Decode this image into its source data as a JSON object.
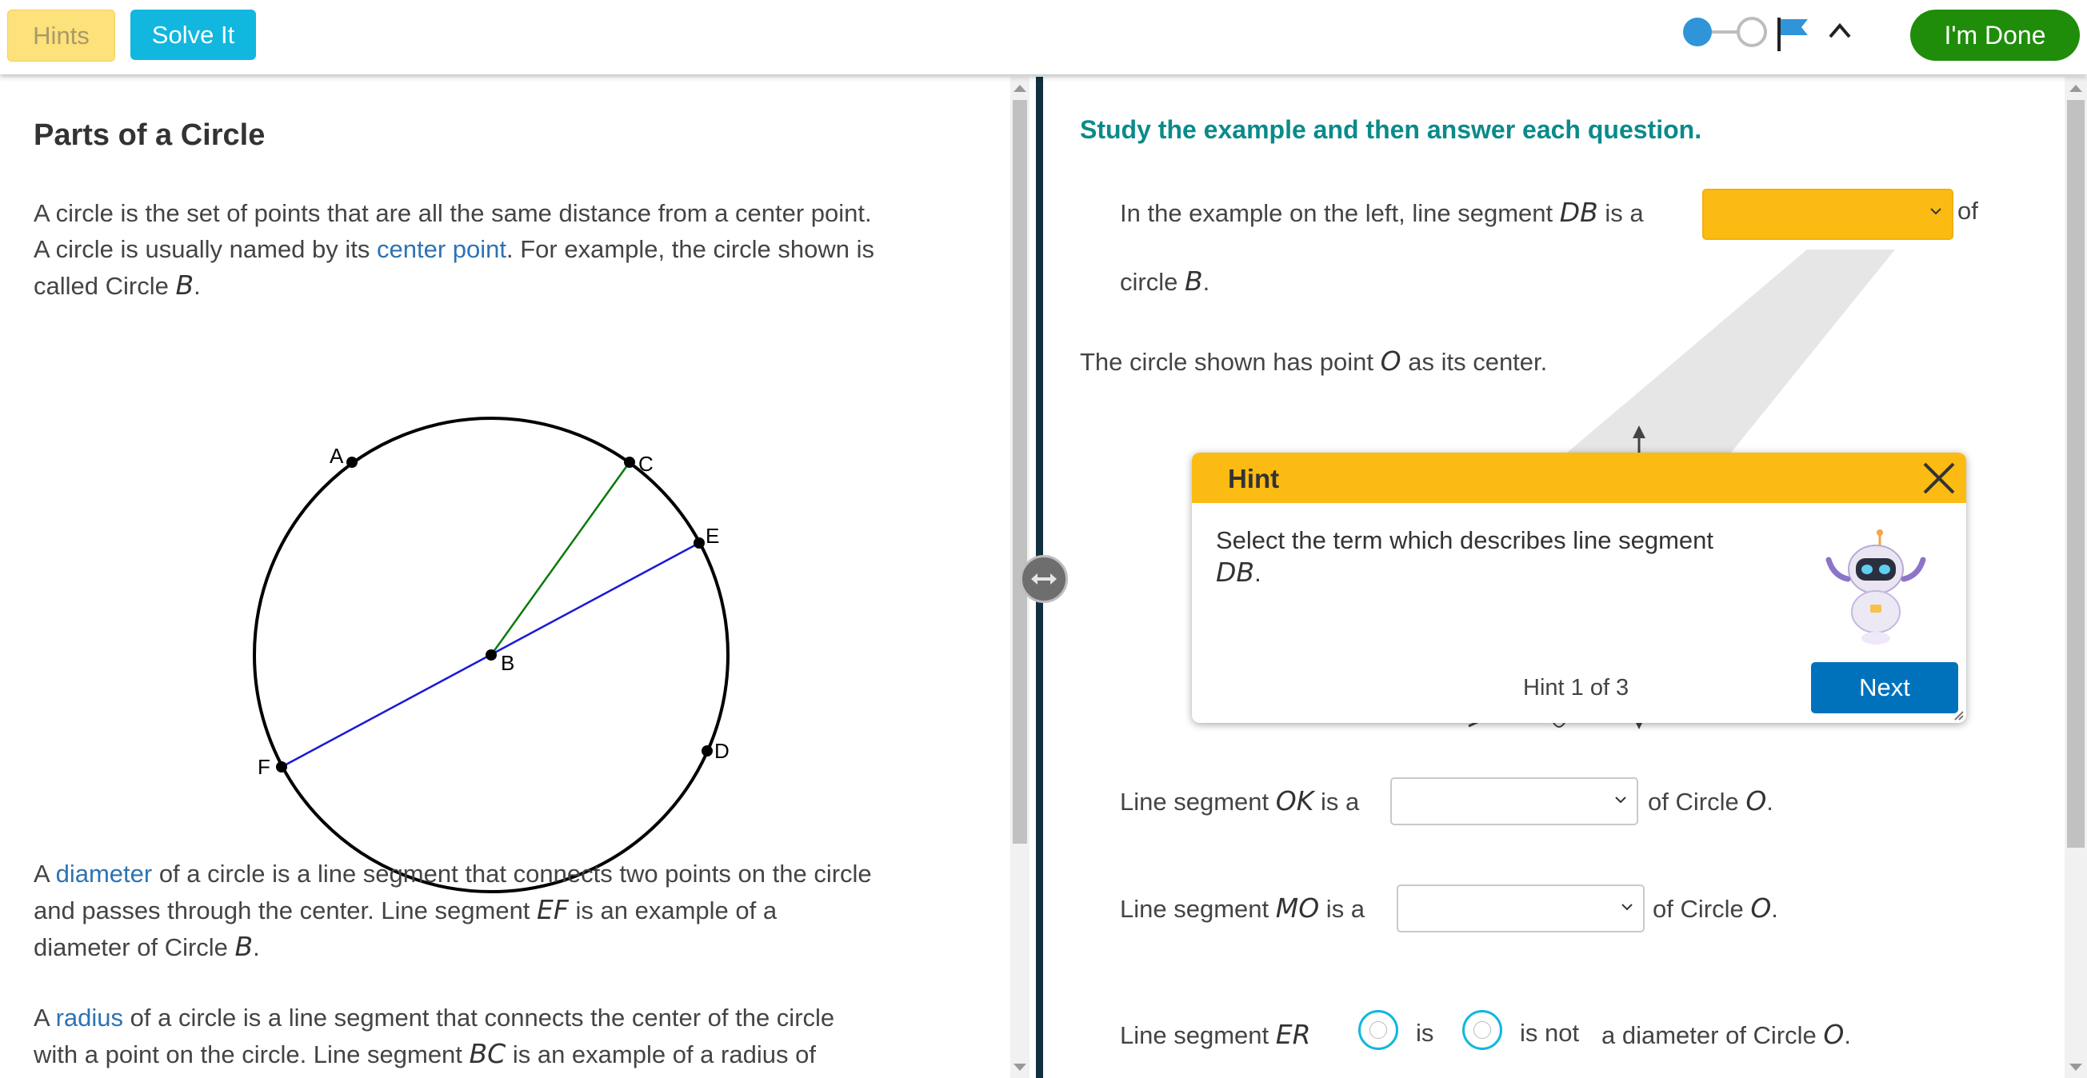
{
  "toolbar": {
    "hints_label": "Hints",
    "solve_label": "Solve It",
    "done_label": "I'm Done",
    "progress_icons": [
      "filled-step-icon",
      "empty-step-icon",
      "flag-icon",
      "collapse-caret-icon"
    ]
  },
  "lesson": {
    "title": "Parts of a Circle",
    "intro": {
      "p1": "A circle is the set of points that are all the same distance from a center point.",
      "p2_before": "A circle is usually named by its ",
      "p2_link": "center point",
      "p2_after": ". For example, the circle shown is",
      "p3_before": "called Circle ",
      "p3_var": "B",
      "p3_after": "."
    },
    "diagram_labels": {
      "A": "A",
      "B": "B",
      "C": "C",
      "D": "D",
      "E": "E",
      "F": "F"
    },
    "diameter_para": {
      "l1_before": "A ",
      "l1_link": "diameter",
      "l1_after": " of a circle is a line segment that connects two points on the circle",
      "l2_before": "and passes through the center. Line segment ",
      "l2_var": "EF",
      "l2_after": " is an example of a",
      "l3_before": "diameter of Circle ",
      "l3_var": "B",
      "l3_after": "."
    },
    "radius_para": {
      "l1_before": "A ",
      "l1_link": "radius",
      "l1_after": " of a circle is a line segment that connects the center of the circle",
      "l2_before": "with a point on the circle. Line segment ",
      "l2_var": "BC",
      "l2_after": " is an example of a radius of"
    }
  },
  "colors": {
    "accent_teal": "#0b8a8a",
    "hint_yellow": "#fcbb13",
    "solve_blue": "#11b7df",
    "done_green": "#1f8d0a",
    "next_blue": "#0072bc",
    "link_blue": "#2d73b3",
    "radius_green": "#0a7a0a",
    "diameter_blue": "#1a1ad6"
  },
  "questions": {
    "instructions": "Study the example and then answer each question.",
    "q1": {
      "before": "In the example on the left, line segment ",
      "var": "DB",
      "mid": " is a",
      "after": " of",
      "line2_before": "circle ",
      "line2_var": "B",
      "line2_after": "."
    },
    "circle_o": {
      "before": "The circle shown has point ",
      "var": "O",
      "after": " as its center."
    },
    "q2": {
      "before": "Line segment ",
      "var": "OK",
      "mid": " is a",
      "after": " of Circle ",
      "after_var": "O",
      "end": "."
    },
    "q3": {
      "before": "Line segment ",
      "var": "MO",
      "mid": " is a",
      "after": " of Circle ",
      "after_var": "O",
      "end": "."
    },
    "q4": {
      "before": "Line segment ",
      "var": "ER",
      "opt1": "is",
      "opt2": "is not",
      "after": "a diameter of Circle ",
      "after_var": "O",
      "end": "."
    }
  },
  "hint": {
    "title": "Hint",
    "body": "Select the term which describes line segment",
    "body_var": "DB",
    "body_end": ".",
    "counter": "Hint 1 of 3",
    "next_label": "Next"
  }
}
